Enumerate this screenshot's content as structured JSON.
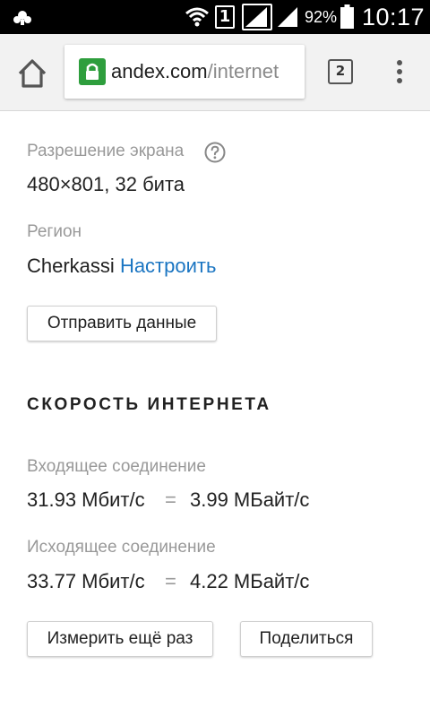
{
  "status_bar": {
    "battery_percent": "92%",
    "time": "10:17",
    "sim_slot": "1",
    "icons": [
      "app-notification-icon",
      "wifi-icon",
      "sim-icon",
      "signal-icon",
      "signal-icon",
      "battery-icon"
    ]
  },
  "browser": {
    "url_host": "andex.com",
    "url_path": "/internet",
    "tab_count": "2",
    "icons": [
      "home-icon",
      "lock-icon",
      "menu-dots-icon"
    ],
    "colors": {
      "lock": "#2e9e3d",
      "link": "#1a75c2"
    }
  },
  "info": {
    "resolution_label": "Разрешение экрана",
    "resolution_value": "480×801, 32 бита",
    "region_label": "Регион",
    "region_value": "Cherkassi",
    "region_link": "Настроить",
    "send_button": "Отправить данные"
  },
  "speed": {
    "title": "СКОРОСТЬ ИНТЕРНЕТА",
    "download_label": "Входящее соединение",
    "download_mbit": "31.93 Мбит/с",
    "download_mbyte": "3.99 МБайт/с",
    "upload_label": "Исходящее соединение",
    "upload_mbit": "33.77 Мбит/с",
    "upload_mbyte": "4.22 МБайт/с",
    "equals": "=",
    "measure_button": "Измерить ещё раз",
    "share_button": "Поделиться"
  }
}
